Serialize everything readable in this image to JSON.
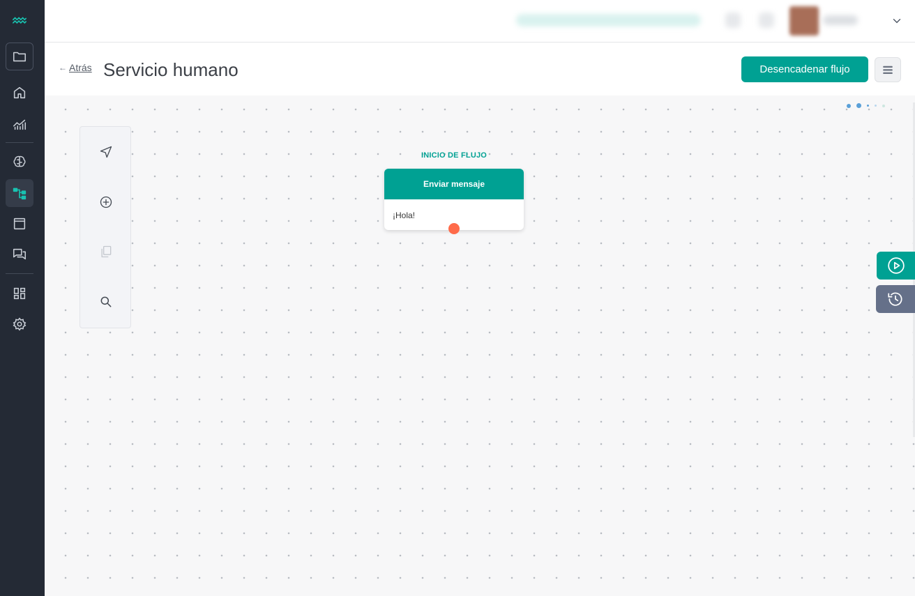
{
  "colors": {
    "sidebar_bg": "#242a35",
    "accent": "#00a193",
    "port": "#ff6b4a",
    "history_button": "#657089"
  },
  "sidebar": {
    "items": [
      {
        "icon": "waves-logo-icon"
      },
      {
        "icon": "folder-icon"
      },
      {
        "icon": "home-icon"
      },
      {
        "icon": "analytics-icon"
      },
      {
        "icon": "brain-icon"
      },
      {
        "icon": "flow-tree-icon",
        "active": true
      },
      {
        "icon": "window-icon"
      },
      {
        "icon": "chat-icon"
      },
      {
        "icon": "dashboard-icon"
      },
      {
        "icon": "settings-icon"
      }
    ]
  },
  "topbar": {
    "user_menu_icon": "chevron-down-icon"
  },
  "header": {
    "back_arrow": "←",
    "back_label": "Atrás",
    "title": "Servicio humano",
    "trigger_button": "Desencadenar flujo",
    "menu_icon": "hamburger-icon"
  },
  "toolbar": {
    "tools": [
      "navigate-icon",
      "add-node-icon",
      "copy-icon",
      "zoom-search-icon"
    ]
  },
  "flow": {
    "start_label": "INICIO DE FLUJO",
    "node": {
      "header": "Enviar mensaje",
      "body": "¡Hola!"
    }
  },
  "side_actions": {
    "play_icon": "play-circle-icon",
    "history_icon": "history-icon"
  }
}
